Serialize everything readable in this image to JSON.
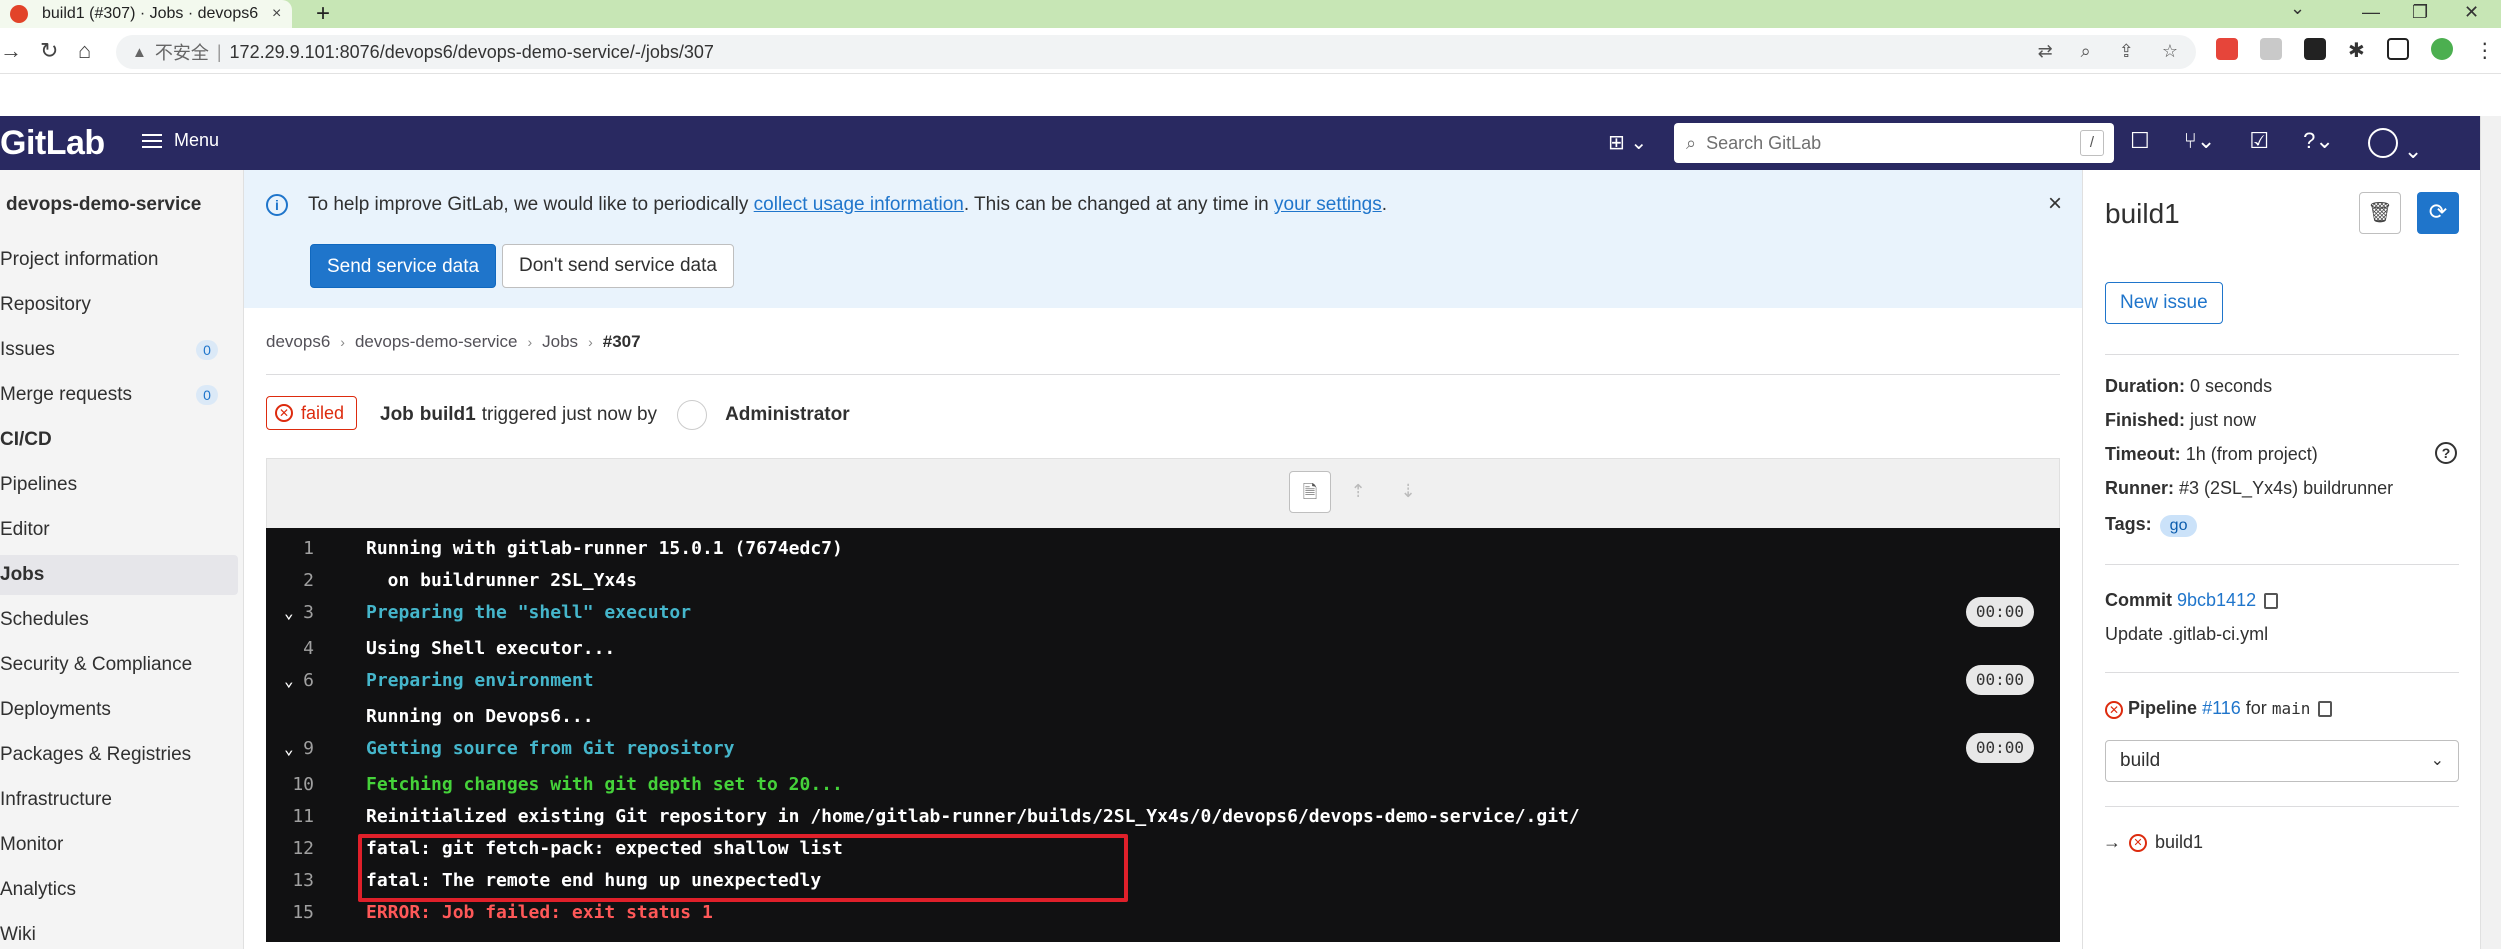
{
  "browser": {
    "tab_title": "build1 (#307) · Jobs · devops6",
    "tab_close": "×",
    "new_tab": "+",
    "insecure_label": "不安全",
    "separator": "|",
    "url": "172.29.9.101:8076/devops6/devops-demo-service/-/jobs/307"
  },
  "topbar": {
    "logo": "GitLab",
    "menu_label": "Menu",
    "search_placeholder": "Search GitLab",
    "search_shortcut": "/"
  },
  "sidebar": {
    "project": "devops-demo-service",
    "items": [
      {
        "label": "Project information"
      },
      {
        "label": "Repository"
      },
      {
        "label": "Issues",
        "count": "0"
      },
      {
        "label": "Merge requests",
        "count": "0"
      },
      {
        "label": "CI/CD"
      },
      {
        "label": "Pipelines"
      },
      {
        "label": "Editor"
      },
      {
        "label": "Jobs"
      },
      {
        "label": "Schedules"
      },
      {
        "label": "Security & Compliance"
      },
      {
        "label": "Deployments"
      },
      {
        "label": "Packages & Registries"
      },
      {
        "label": "Infrastructure"
      },
      {
        "label": "Monitor"
      },
      {
        "label": "Analytics"
      },
      {
        "label": "Wiki"
      }
    ]
  },
  "banner": {
    "text_before": "To help improve GitLab, we would like to periodically ",
    "link1": "collect usage information",
    "text_middle": ". This can be changed at any time in ",
    "link2": "your settings",
    "text_after": ".",
    "primary_button": "Send service data",
    "secondary_button": "Don't send service data",
    "close": "×"
  },
  "breadcrumb": {
    "items": [
      "devops6",
      "devops-demo-service",
      "Jobs",
      "#307"
    ],
    "separator": "›"
  },
  "job": {
    "status": "failed",
    "prefix": "Job",
    "name": "build1",
    "triggered": "triggered just now by",
    "user": "Administrator"
  },
  "log": {
    "lines": [
      {
        "n": "1",
        "text": "Running with gitlab-runner 15.0.1 (7674edc7)",
        "style": "bold"
      },
      {
        "n": "2",
        "text": "  on buildrunner 2SL_Yx4s",
        "style": "bold"
      },
      {
        "n": "3",
        "text": "Preparing the \"shell\" executor",
        "style": "cyan",
        "collapsible": true,
        "time": "00:00"
      },
      {
        "n": "4",
        "text": "Using Shell executor...",
        "style": "bold"
      },
      {
        "n": "6",
        "text": "Preparing environment",
        "style": "cyan",
        "collapsible": true,
        "time": "00:00"
      },
      {
        "n": "",
        "text": "Running on Devops6...",
        "style": "bold"
      },
      {
        "n": "9",
        "text": "Getting source from Git repository",
        "style": "cyan",
        "collapsible": true,
        "time": "00:00"
      },
      {
        "n": "10",
        "text": "Fetching changes with git depth set to 20...",
        "style": "green"
      },
      {
        "n": "11",
        "text": "Reinitialized existing Git repository in /home/gitlab-runner/builds/2SL_Yx4s/0/devops6/devops-demo-service/.git/",
        "style": "bold"
      },
      {
        "n": "12",
        "text": "fatal: git fetch-pack: expected shallow list",
        "style": "bold"
      },
      {
        "n": "13",
        "text": "fatal: The remote end hung up unexpectedly",
        "style": "bold"
      },
      {
        "n": "15",
        "text": "ERROR: Job failed: exit status 1",
        "style": "red"
      }
    ]
  },
  "right": {
    "title": "build1",
    "new_issue": "New issue",
    "duration_label": "Duration:",
    "duration": "0 seconds",
    "finished_label": "Finished:",
    "finished": "just now",
    "timeout_label": "Timeout:",
    "timeout": "1h (from project)",
    "runner_label": "Runner:",
    "runner": "#3 (2SL_Yx4s) buildrunner",
    "tags_label": "Tags:",
    "tag": "go",
    "commit_label": "Commit",
    "commit_sha": "9bcb1412",
    "commit_msg": "Update .gitlab-ci.yml",
    "pipeline_label": "Pipeline",
    "pipeline_id": "#116",
    "pipeline_for": "for",
    "branch": "main",
    "stage": "build",
    "job_link": "build1",
    "arrow": "→"
  },
  "colors": {
    "topbar": "#292961",
    "primary": "#1f75cb",
    "danger": "#dd2b0e",
    "log_bg": "#111112",
    "highlight_box": "#e0202a"
  }
}
